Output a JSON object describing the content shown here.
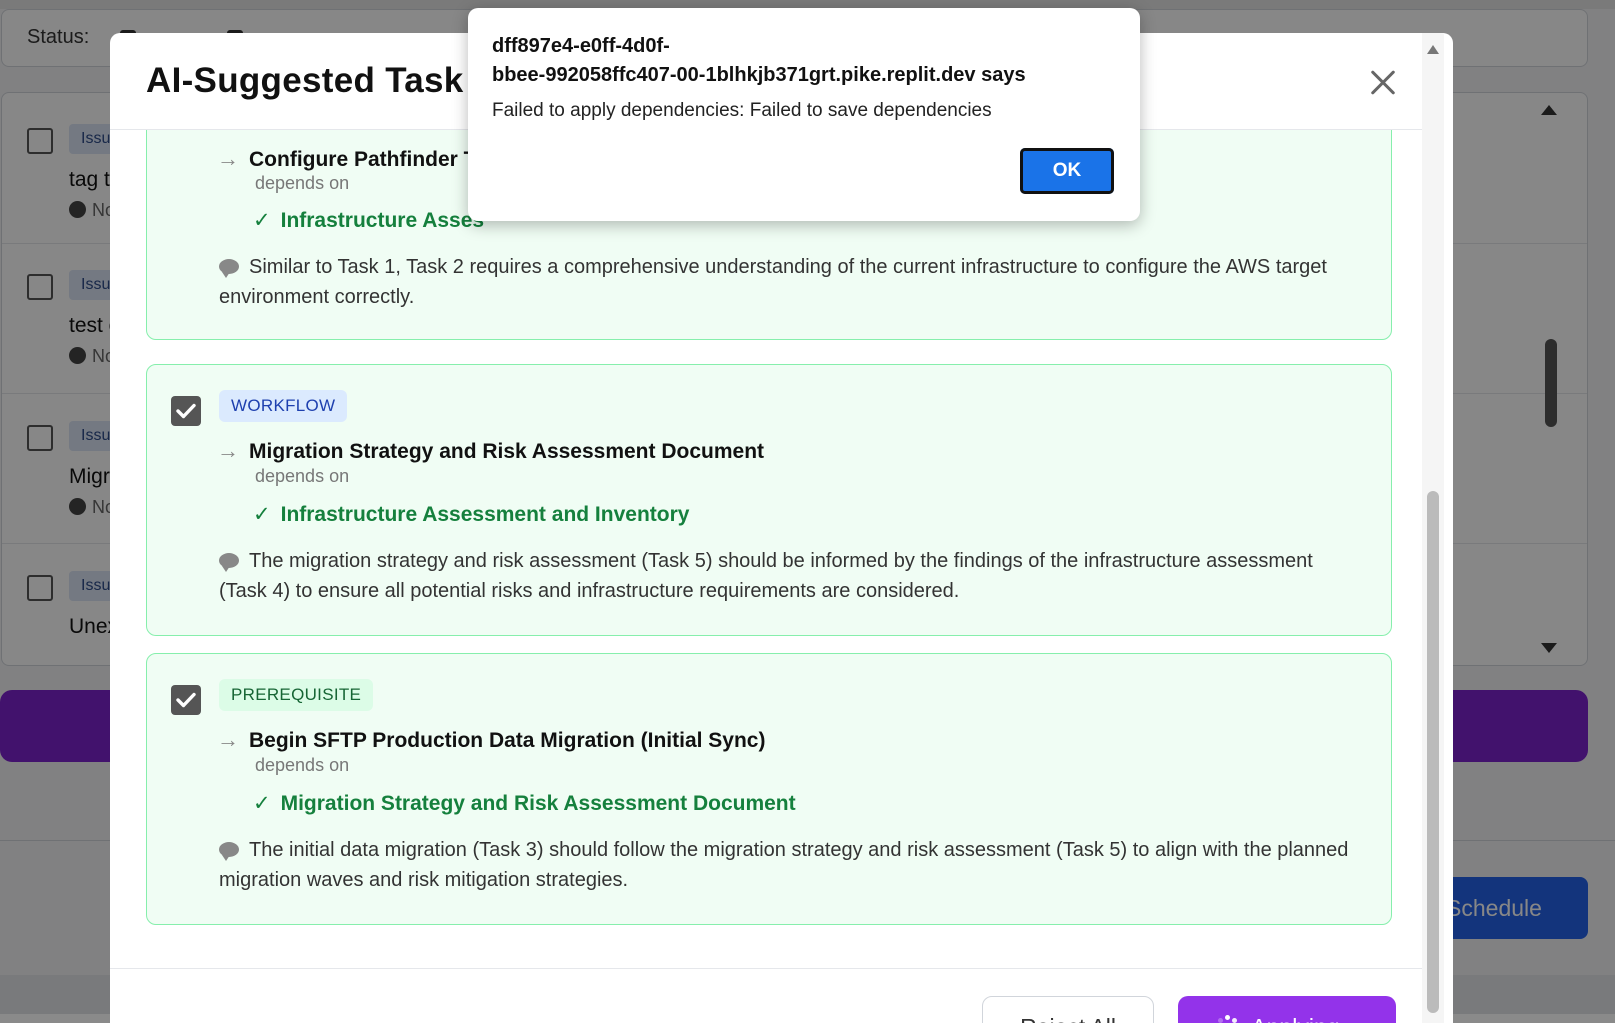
{
  "background": {
    "status_label": "Status:",
    "items": [
      {
        "tag": "Issu",
        "title": "tag t",
        "meta": "No"
      },
      {
        "tag": "Issu",
        "title": "test c",
        "meta": "No"
      },
      {
        "tag": "Issu",
        "title": "Migr",
        "meta": "No"
      },
      {
        "tag": "Issu",
        "title": "Unex",
        "meta": ""
      }
    ],
    "schedule_label": "Schedule"
  },
  "modal": {
    "title": "AI-Suggested Task",
    "cards": [
      {
        "type": "",
        "checked": true,
        "task": "Configure Pathfinder Ta",
        "depends_label": "depends on",
        "depends_on": "Infrastructure Asses",
        "reason": "Similar to Task 1, Task 2 requires a comprehensive understanding of the current infrastructure to configure the AWS target environment correctly."
      },
      {
        "type": "WORKFLOW",
        "checked": true,
        "task": "Migration Strategy and Risk Assessment Document",
        "depends_label": "depends on",
        "depends_on": "Infrastructure Assessment and Inventory",
        "reason": "The migration strategy and risk assessment (Task 5) should be informed by the findings of the infrastructure assessment (Task 4) to ensure all potential risks and infrastructure requirements are considered."
      },
      {
        "type": "PREREQUISITE",
        "checked": true,
        "task": "Begin SFTP Production Data Migration (Initial Sync)",
        "depends_label": "depends on",
        "depends_on": "Migration Strategy and Risk Assessment Document",
        "reason": "The initial data migration (Task 3) should follow the migration strategy and risk assessment (Task 5) to align with the planned migration waves and risk mitigation strategies."
      }
    ],
    "reject_label": "Reject All",
    "apply_label": "Applying..."
  },
  "alert": {
    "title_line1": "dff897e4-e0ff-4d0f-",
    "title_line2": "bbee-992058ffc407-00-1blhkjb371grt.pike.replit.dev says",
    "message": "Failed to apply dependencies: Failed to save dependencies",
    "ok_label": "OK"
  },
  "colors": {
    "accent_purple": "#9333ea",
    "card_bg": "#f0fdf4",
    "card_border": "#86efac",
    "dependency_green": "#15803d",
    "ok_blue": "#1a73e8"
  }
}
